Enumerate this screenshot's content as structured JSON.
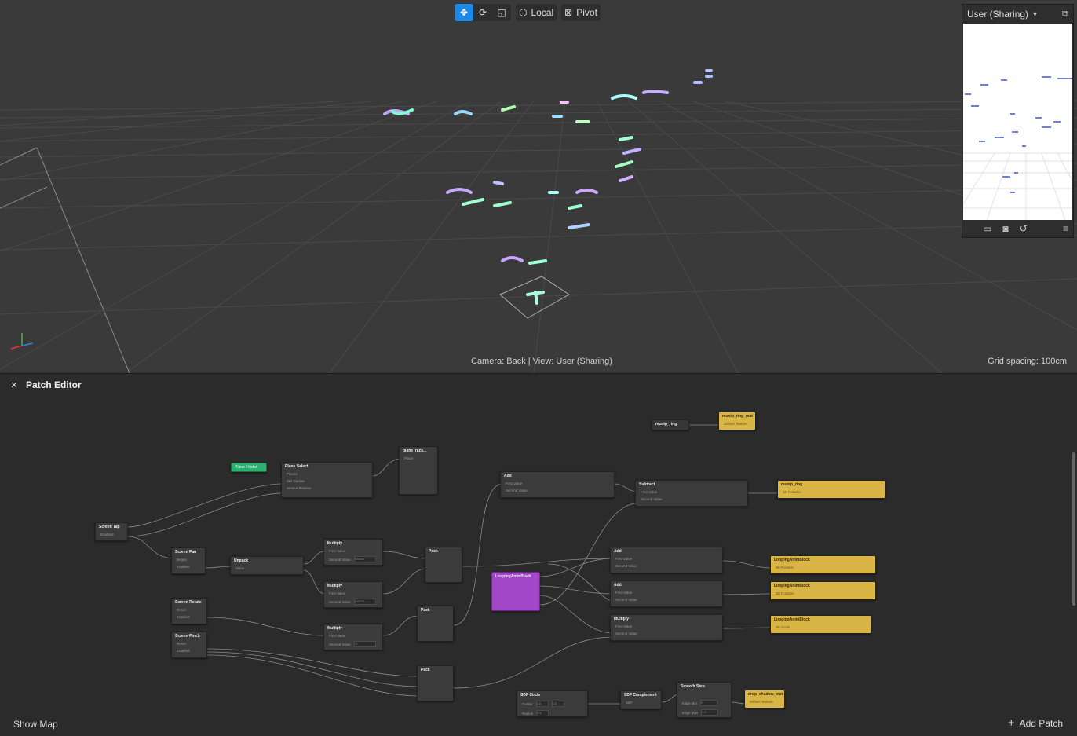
{
  "toolbar": {
    "local_label": "Local",
    "pivot_label": "Pivot"
  },
  "viewport": {
    "camera_status": "Camera: Back | View: User (Sharing)",
    "grid_status": "Grid spacing: 100cm"
  },
  "preview": {
    "device_label": "User (Sharing)"
  },
  "patch_editor": {
    "title": "Patch Editor",
    "show_map_label": "Show Map",
    "add_patch_label": "Add Patch",
    "nodes": {
      "plane_finder": "Plane Finder",
      "plane_select": "Plane Select",
      "plane_select_rows": [
        "Planes",
        "Set Tracker",
        "Screen Position"
      ],
      "plane_track": "planeTrack...",
      "plane_track_row": "Plane",
      "screen_tap": "Screen Tap",
      "enabled": "Enabled",
      "screen_pan": "Screen Pan",
      "began": "Began",
      "unpack": "Unpack",
      "value": "Value",
      "multiply": "Multiply",
      "first_value": "First Value",
      "second_value": "Second Value",
      "multiply_1_second": "0.0005",
      "multiply_2_second": "0.0005",
      "multiply_3_second": "-1",
      "pack": "Pack",
      "add": "Add",
      "subtract": "Subtract",
      "looping_anim_block": "LoopingAnimBlock",
      "screen_rotate": "Screen Rotate",
      "screen_pinch": "Screen Pinch",
      "reset": "Reset",
      "munip_ring_patch": "munip_ring",
      "munip_ring_mat": "munip_ring_mat",
      "diffuse_texture": "Diffuse Texture",
      "munip_ring_obj": "munip_ring",
      "rotation_3d": "3D Rotation",
      "position_3d": "3D Position",
      "scale_3d": "3D Scale",
      "sdf_circle": "SDF Circle",
      "center": "Center",
      "radius": "Radius",
      "sdf_circle_center_x": "0.5",
      "sdf_circle_center_y": "0.5",
      "sdf_circle_radius": "0.5",
      "sdf_complement": "SDF Complement",
      "sdf": "SDF",
      "smooth_step": "Smooth Step",
      "edge_min": "Edge Min",
      "edge_max": "Edge Max",
      "smooth_edge_min": "0",
      "smooth_edge_max": "0.2",
      "drop_shadow_mat": "drop_shadow_mat"
    }
  },
  "colors": {
    "accent": "#1e88e5",
    "patch_yellow": "#d9b545",
    "patch_green": "#2fae70",
    "patch_purple": "#a347c9"
  }
}
